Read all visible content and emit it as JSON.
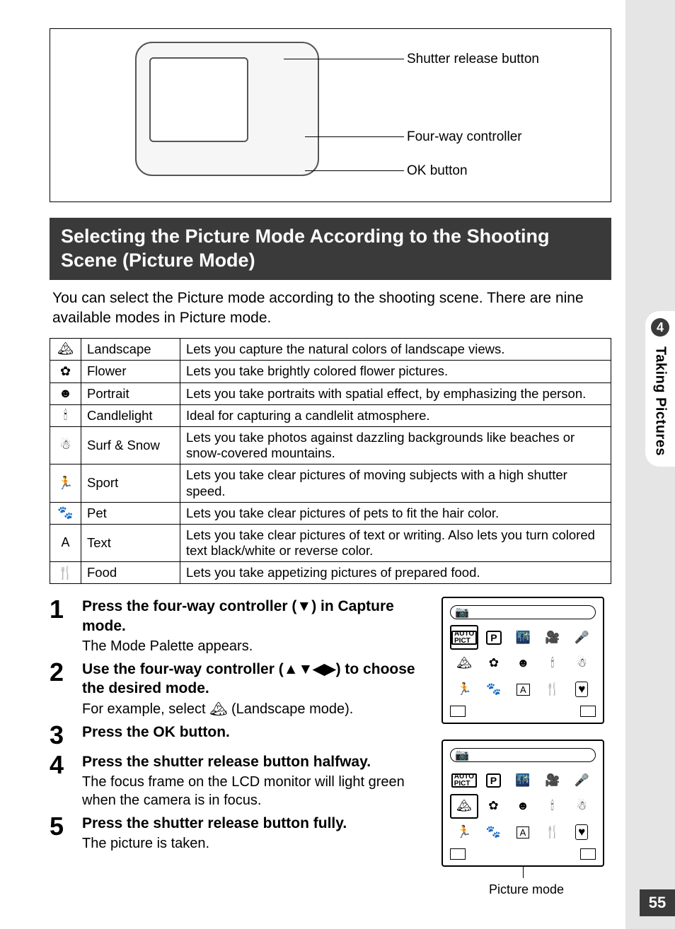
{
  "sidebar": {
    "chapter_num": "4",
    "chapter_title": "Taking Pictures"
  },
  "page_number": "55",
  "callouts": {
    "shutter": "Shutter release button",
    "fourway": "Four-way controller",
    "ok": "OK button"
  },
  "section_title": "Selecting the Picture Mode According to the Shooting Scene (Picture Mode)",
  "intro": "You can select the Picture mode according to the shooting scene. There are nine available modes in Picture mode.",
  "modes": [
    {
      "icon": "🏔",
      "name": "Landscape",
      "desc": "Lets you capture the natural colors of landscape views."
    },
    {
      "icon": "✿",
      "name": "Flower",
      "desc": "Lets you take brightly colored flower pictures."
    },
    {
      "icon": "☻",
      "name": "Portrait",
      "desc": "Lets you take portraits with spatial effect, by emphasizing the person."
    },
    {
      "icon": "🕯",
      "name": "Candlelight",
      "desc": "Ideal for capturing a candlelit atmosphere."
    },
    {
      "icon": "☃",
      "name": "Surf & Snow",
      "desc": "Lets you take photos against dazzling backgrounds like beaches or snow-covered mountains."
    },
    {
      "icon": "🏃",
      "name": "Sport",
      "desc": "Lets you take clear pictures of moving subjects with a high shutter speed."
    },
    {
      "icon": "🐾",
      "name": "Pet",
      "desc": "Lets you take clear pictures of pets to fit the hair color."
    },
    {
      "icon": "A",
      "name": "Text",
      "desc": "Lets you take clear pictures of text or writing. Also lets you turn colored text black/white or reverse color."
    },
    {
      "icon": "🍴",
      "name": "Food",
      "desc": "Lets you take appetizing pictures of prepared food."
    }
  ],
  "steps": [
    {
      "num": "1",
      "title": "Press the four-way controller (▼) in Capture mode.",
      "desc": "The Mode Palette appears."
    },
    {
      "num": "2",
      "title": "Use the four-way controller (▲▼◀▶) to choose the desired mode.",
      "desc": "For example, select 🏔 (Landscape mode)."
    },
    {
      "num": "3",
      "title": "Press the OK button.",
      "desc": ""
    },
    {
      "num": "4",
      "title": "Press the shutter release button halfway.",
      "desc": "The focus frame on the LCD monitor will light green when the camera is in focus."
    },
    {
      "num": "5",
      "title": "Press the shutter release button fully.",
      "desc": "The picture is taken."
    }
  ],
  "lcd_caption": "Picture mode",
  "lcd_icons_row1": [
    "AUTO",
    "P",
    "🌃",
    "🎥",
    "🎤"
  ],
  "lcd_icons_row2": [
    "🏔",
    "✿",
    "☻",
    "🕯",
    "☃"
  ],
  "lcd_icons_row3": [
    "🏃",
    "🐾",
    "A",
    "🍴",
    "♥"
  ]
}
